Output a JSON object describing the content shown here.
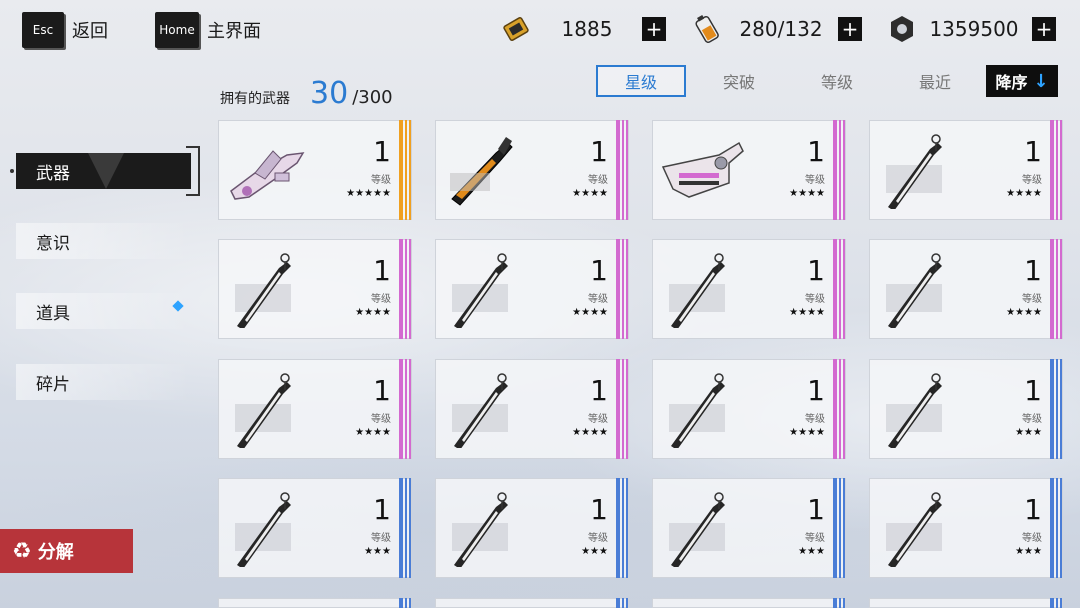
{
  "topbar": {
    "esc_key": "Esc",
    "esc_label": "返回",
    "home_key": "Home",
    "home_label": "主界面",
    "resources": [
      {
        "icon": "gold-ticket-icon",
        "value": "1885"
      },
      {
        "icon": "battery-icon",
        "value": "280/132"
      },
      {
        "icon": "nut-coin-icon",
        "value": "1359500"
      }
    ],
    "plus": "+"
  },
  "sort": {
    "tabs": [
      {
        "label": "星级",
        "active": true
      },
      {
        "label": "突破",
        "active": false
      },
      {
        "label": "等级",
        "active": false
      },
      {
        "label": "最近",
        "active": false
      }
    ],
    "order_label": "降序",
    "order_arrow": "↓"
  },
  "inventory": {
    "owned_label": "拥有的武器",
    "owned_count": "30",
    "capacity": "/300"
  },
  "sidebar": {
    "items": [
      {
        "label": "武器",
        "active": true
      },
      {
        "label": "意识",
        "active": false
      },
      {
        "label": "道具",
        "active": false,
        "has_new": true
      },
      {
        "label": "碎片",
        "active": false
      }
    ]
  },
  "decompose": {
    "label": "分解",
    "icon": "recycle-icon"
  },
  "colors": {
    "accent": "#2b7bd1",
    "gold": "#f0a020",
    "pink": "#d36ad0",
    "blue": "#4a7dd6",
    "danger": "#b7343a"
  },
  "weapons": [
    {
      "level": "1",
      "level_label": "等级",
      "stars": "★★★★★",
      "rarity": "gold",
      "kind": "cannon-pink"
    },
    {
      "level": "1",
      "level_label": "等级",
      "stars": "★★★★",
      "rarity": "pink",
      "kind": "blade-dark"
    },
    {
      "level": "1",
      "level_label": "等级",
      "stars": "★★★★",
      "rarity": "pink",
      "kind": "cannon-big"
    },
    {
      "level": "1",
      "level_label": "等级",
      "stars": "★★★★",
      "rarity": "pink",
      "kind": "katana"
    },
    {
      "level": "1",
      "level_label": "等级",
      "stars": "★★★★",
      "rarity": "pink",
      "kind": "katana"
    },
    {
      "level": "1",
      "level_label": "等级",
      "stars": "★★★★",
      "rarity": "pink",
      "kind": "katana"
    },
    {
      "level": "1",
      "level_label": "等级",
      "stars": "★★★★",
      "rarity": "pink",
      "kind": "katana"
    },
    {
      "level": "1",
      "level_label": "等级",
      "stars": "★★★★",
      "rarity": "pink",
      "kind": "katana"
    },
    {
      "level": "1",
      "level_label": "等级",
      "stars": "★★★★",
      "rarity": "pink",
      "kind": "katana"
    },
    {
      "level": "1",
      "level_label": "等级",
      "stars": "★★★★",
      "rarity": "pink",
      "kind": "katana"
    },
    {
      "level": "1",
      "level_label": "等级",
      "stars": "★★★★",
      "rarity": "pink",
      "kind": "katana"
    },
    {
      "level": "1",
      "level_label": "等级",
      "stars": "★★★",
      "rarity": "blue",
      "kind": "katana"
    },
    {
      "level": "1",
      "level_label": "等级",
      "stars": "★★★",
      "rarity": "blue",
      "kind": "katana"
    },
    {
      "level": "1",
      "level_label": "等级",
      "stars": "★★★",
      "rarity": "blue",
      "kind": "katana"
    },
    {
      "level": "1",
      "level_label": "等级",
      "stars": "★★★",
      "rarity": "blue",
      "kind": "katana"
    },
    {
      "level": "1",
      "level_label": "等级",
      "stars": "★★★",
      "rarity": "blue",
      "kind": "katana"
    }
  ]
}
